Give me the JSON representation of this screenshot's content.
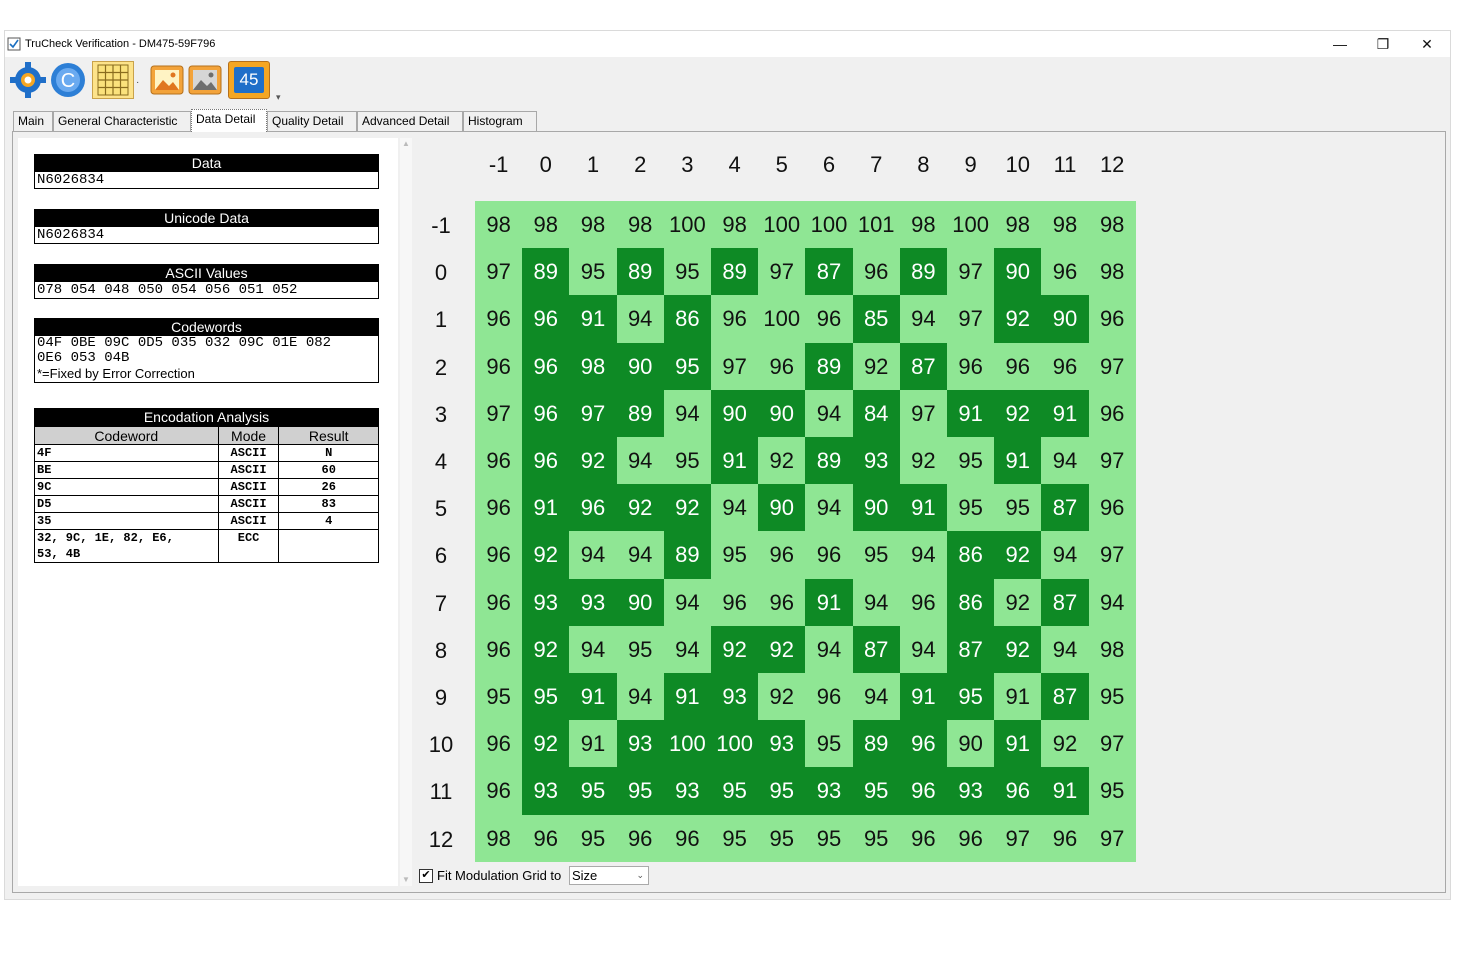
{
  "window": {
    "title": "TruCheck Verification - DM475-59F796"
  },
  "toolbar": {
    "badge": "45"
  },
  "tabs": [
    "Main",
    "General Characteristic",
    "Data Detail",
    "Quality Detail",
    "Advanced Detail",
    "Histogram"
  ],
  "active_tab": "Data Detail",
  "data_panel": {
    "title": "Data",
    "value": "N6026834"
  },
  "unicode_panel": {
    "title": "Unicode Data",
    "value": "N6026834"
  },
  "ascii_panel": {
    "title": "ASCII Values",
    "value": "078 054 048 050 054 056 051 052"
  },
  "codewords_panel": {
    "title": "Codewords",
    "line1": "04F 0BE 09C 0D5 035 032 09C 01E 082",
    "line2": "0E6 053 04B",
    "note": "*=Fixed by Error Correction"
  },
  "encodation": {
    "title": "Encodation Analysis",
    "headers": [
      "Codeword",
      "Mode",
      "Result"
    ],
    "rows": [
      [
        "4F",
        "ASCII",
        "N"
      ],
      [
        "BE",
        "ASCII",
        "60"
      ],
      [
        "9C",
        "ASCII",
        "26"
      ],
      [
        "D5",
        "ASCII",
        "83"
      ],
      [
        "35",
        "ASCII",
        "4"
      ],
      [
        "32, 9C, 1E, 82, E6,\n53, 4B",
        "ECC",
        ""
      ]
    ]
  },
  "grid": {
    "col_labels": [
      "-1",
      "0",
      "1",
      "2",
      "3",
      "4",
      "5",
      "6",
      "7",
      "8",
      "9",
      "10",
      "11",
      "12"
    ],
    "row_labels": [
      "-1",
      "0",
      "1",
      "2",
      "3",
      "4",
      "5",
      "6",
      "7",
      "8",
      "9",
      "10",
      "11",
      "12"
    ],
    "colors": {
      "light": "#8fe694",
      "dark": "#0e8a25"
    },
    "values": [
      [
        98,
        98,
        98,
        98,
        100,
        98,
        100,
        100,
        101,
        98,
        100,
        98,
        98,
        98
      ],
      [
        97,
        89,
        95,
        89,
        95,
        89,
        97,
        87,
        96,
        89,
        97,
        90,
        96,
        98
      ],
      [
        96,
        96,
        91,
        94,
        86,
        96,
        100,
        96,
        85,
        94,
        97,
        92,
        90,
        96
      ],
      [
        96,
        96,
        98,
        90,
        95,
        97,
        96,
        89,
        92,
        87,
        96,
        96,
        96,
        97
      ],
      [
        97,
        96,
        97,
        89,
        94,
        90,
        90,
        94,
        84,
        97,
        91,
        92,
        91,
        96
      ],
      [
        96,
        96,
        92,
        94,
        95,
        91,
        92,
        89,
        93,
        92,
        95,
        91,
        94,
        97
      ],
      [
        96,
        91,
        96,
        92,
        92,
        94,
        90,
        94,
        90,
        91,
        95,
        95,
        87,
        96
      ],
      [
        96,
        92,
        94,
        94,
        89,
        95,
        96,
        96,
        95,
        94,
        86,
        92,
        94,
        97
      ],
      [
        96,
        93,
        93,
        90,
        94,
        96,
        96,
        91,
        94,
        96,
        86,
        92,
        87,
        94
      ],
      [
        96,
        92,
        94,
        95,
        94,
        92,
        92,
        94,
        87,
        94,
        87,
        92,
        94,
        98
      ],
      [
        95,
        95,
        91,
        94,
        91,
        93,
        92,
        96,
        94,
        91,
        95,
        91,
        87,
        95
      ],
      [
        96,
        92,
        91,
        93,
        100,
        100,
        93,
        95,
        89,
        96,
        90,
        91,
        92,
        97
      ],
      [
        96,
        93,
        95,
        95,
        93,
        95,
        95,
        93,
        95,
        96,
        93,
        96,
        91,
        95
      ],
      [
        98,
        96,
        95,
        96,
        96,
        95,
        95,
        95,
        95,
        96,
        96,
        97,
        96,
        97
      ]
    ],
    "dark": [
      [
        0,
        0,
        0,
        0,
        0,
        0,
        0,
        0,
        0,
        0,
        0,
        0,
        0,
        0
      ],
      [
        0,
        1,
        0,
        1,
        0,
        1,
        0,
        1,
        0,
        1,
        0,
        1,
        0,
        0
      ],
      [
        0,
        1,
        1,
        0,
        1,
        0,
        0,
        0,
        1,
        0,
        0,
        1,
        1,
        0
      ],
      [
        0,
        1,
        1,
        1,
        1,
        0,
        0,
        1,
        0,
        1,
        0,
        0,
        0,
        0
      ],
      [
        0,
        1,
        1,
        1,
        0,
        1,
        1,
        0,
        1,
        0,
        1,
        1,
        1,
        0
      ],
      [
        0,
        1,
        1,
        0,
        0,
        1,
        0,
        1,
        1,
        0,
        0,
        1,
        0,
        0
      ],
      [
        0,
        1,
        1,
        1,
        1,
        0,
        1,
        0,
        1,
        1,
        0,
        0,
        1,
        0
      ],
      [
        0,
        1,
        0,
        0,
        1,
        0,
        0,
        0,
        0,
        0,
        1,
        1,
        0,
        0
      ],
      [
        0,
        1,
        1,
        1,
        0,
        0,
        0,
        1,
        0,
        0,
        1,
        0,
        1,
        0
      ],
      [
        0,
        1,
        0,
        0,
        0,
        1,
        1,
        0,
        1,
        0,
        1,
        1,
        0,
        0
      ],
      [
        0,
        1,
        1,
        0,
        1,
        1,
        0,
        0,
        0,
        1,
        1,
        0,
        1,
        0
      ],
      [
        0,
        1,
        0,
        1,
        1,
        1,
        1,
        0,
        1,
        1,
        0,
        1,
        0,
        0
      ],
      [
        0,
        1,
        1,
        1,
        1,
        1,
        1,
        1,
        1,
        1,
        1,
        1,
        1,
        0
      ],
      [
        0,
        0,
        0,
        0,
        0,
        0,
        0,
        0,
        0,
        0,
        0,
        0,
        0,
        0
      ]
    ]
  },
  "fit_control": {
    "checkbox_label": "Fit Modulation Grid to",
    "checked": true,
    "selected": "Size"
  }
}
